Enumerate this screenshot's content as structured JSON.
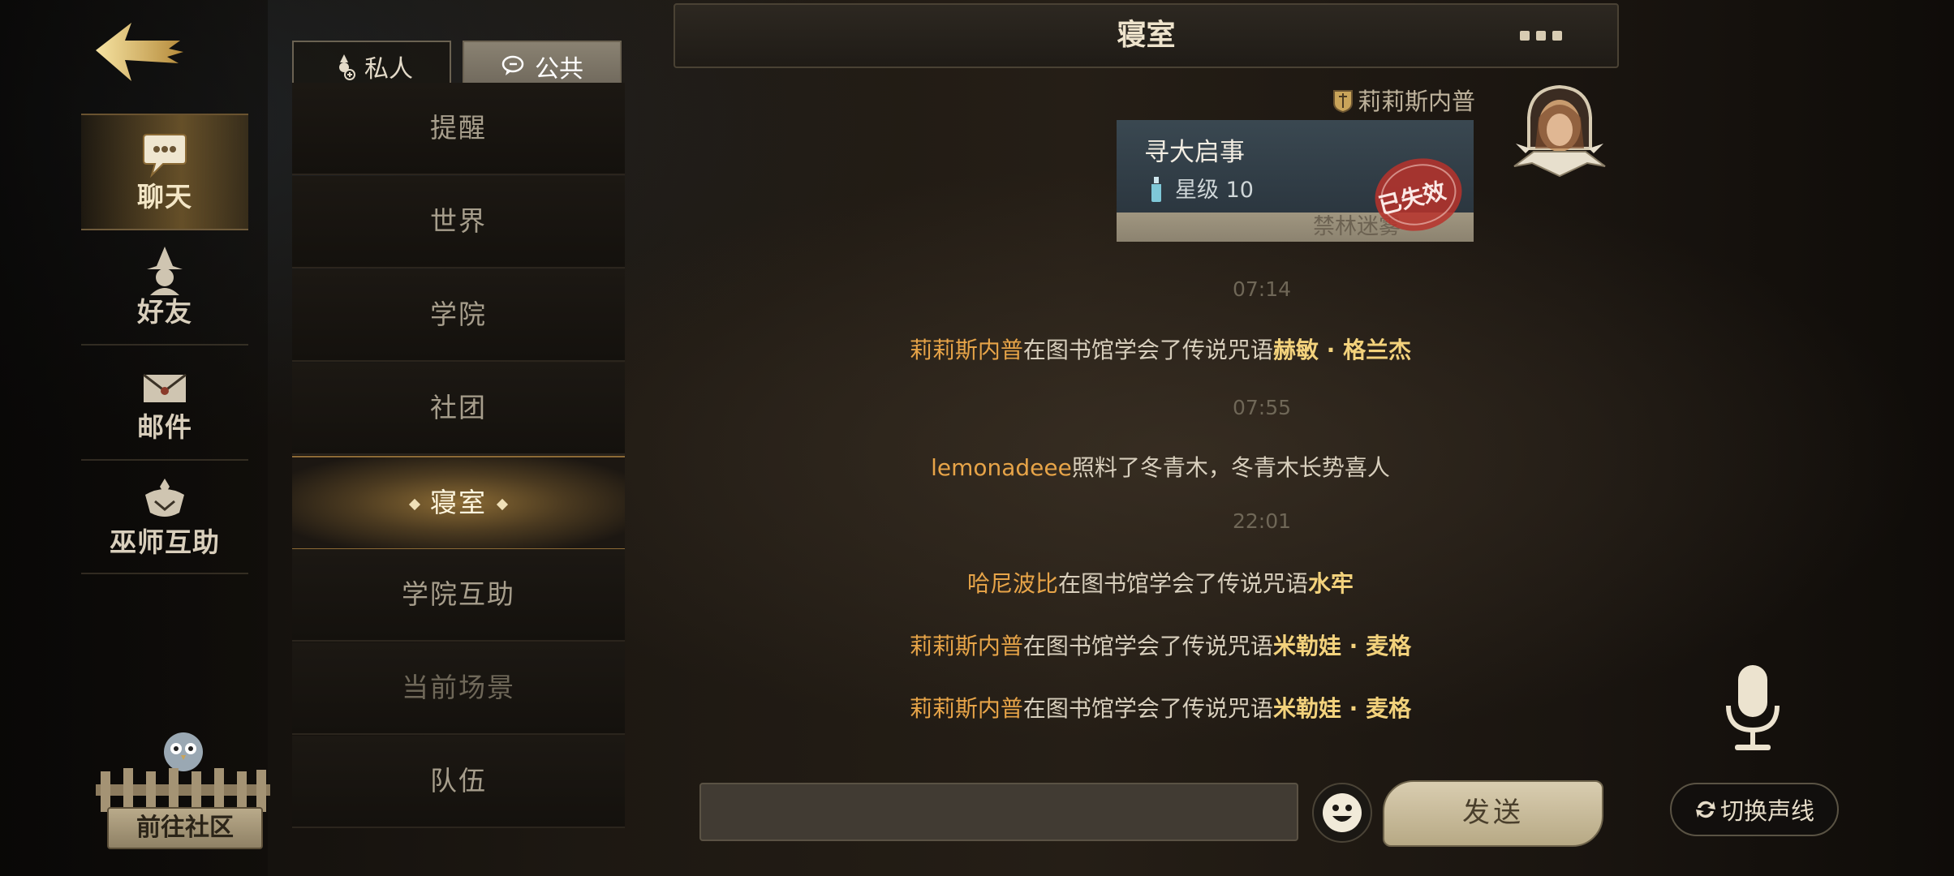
{
  "nav": {
    "items": [
      {
        "label": "聊天",
        "icon": "chat-bubble-icon",
        "active": true
      },
      {
        "label": "好友",
        "icon": "wizard-hat-icon",
        "active": false
      },
      {
        "label": "邮件",
        "icon": "envelope-icon",
        "active": false
      },
      {
        "label": "巫师互助",
        "icon": "mutual-aid-icon",
        "active": false
      }
    ],
    "community_label": "前往社区"
  },
  "tabs": {
    "private_label": "私人",
    "public_label": "公共",
    "selected": "公共"
  },
  "channels": [
    {
      "label": "提醒"
    },
    {
      "label": "世界"
    },
    {
      "label": "学院"
    },
    {
      "label": "社团"
    },
    {
      "label": "寝室",
      "active": true
    },
    {
      "label": "学院互助"
    },
    {
      "label": "当前场景",
      "dim": true
    },
    {
      "label": "队伍"
    }
  ],
  "chat": {
    "title": "寝室",
    "sender": "莉莉斯内普",
    "card": {
      "title": "寻大启事",
      "star_text": "星级 10",
      "footer": "禁林迷雾",
      "stamp": "已失效"
    },
    "messages": [
      {
        "time": "07:14"
      },
      {
        "name": "莉莉斯内普",
        "text": "在图书馆学会了传说咒语",
        "spell": "赫敏 · 格兰杰"
      },
      {
        "time": "07:55"
      },
      {
        "name": "lemonadeee",
        "text": "照料了冬青木，冬青木长势喜人",
        "spell": ""
      },
      {
        "time": "22:01"
      },
      {
        "name": "哈尼波比",
        "text": "在图书馆学会了传说咒语",
        "spell": "水牢"
      },
      {
        "name": "莉莉斯内普",
        "text": "在图书馆学会了传说咒语",
        "spell": "米勒娃 · 麦格"
      },
      {
        "name": "莉莉斯内普",
        "text": "在图书馆学会了传说咒语",
        "spell": "米勒娃 · 麦格"
      }
    ]
  },
  "input": {
    "placeholder": ""
  },
  "buttons": {
    "send_label": "发送",
    "switch_voice_label": "切换声线"
  },
  "colors": {
    "accent_gold": "#e7a448",
    "spell_gold": "#f3d27c",
    "stamp_red": "#b8332c"
  }
}
